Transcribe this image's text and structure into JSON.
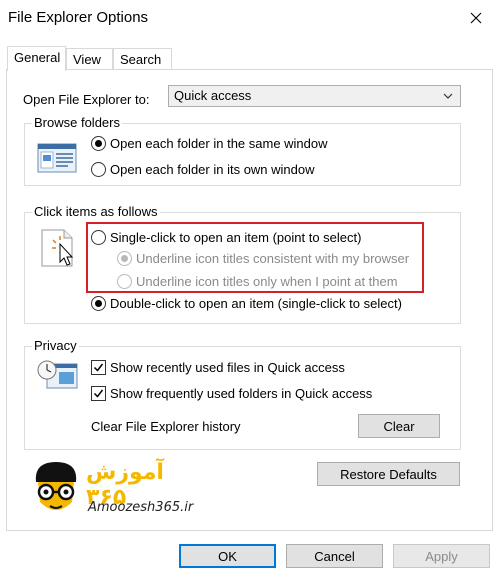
{
  "window": {
    "title": "File Explorer Options"
  },
  "tabs": [
    {
      "label": "General",
      "active": true
    },
    {
      "label": "View",
      "active": false
    },
    {
      "label": "Search",
      "active": false
    }
  ],
  "open_to": {
    "label": "Open File Explorer to:",
    "value": "Quick access"
  },
  "browse_folders": {
    "legend": "Browse folders",
    "options": [
      {
        "label": "Open each folder in the same window",
        "checked": true
      },
      {
        "label": "Open each folder in its own window",
        "checked": false
      }
    ]
  },
  "click_items": {
    "legend": "Click items as follows",
    "single_click": {
      "label": "Single-click to open an item (point to select)",
      "checked": false
    },
    "underline_consistent": {
      "label": "Underline icon titles consistent with my browser",
      "checked": true,
      "disabled": true
    },
    "underline_point": {
      "label": "Underline icon titles only when I point at them",
      "checked": false,
      "disabled": true
    },
    "double_click": {
      "label": "Double-click to open an item (single-click to select)",
      "checked": true
    }
  },
  "privacy": {
    "legend": "Privacy",
    "show_recent_files": {
      "label": "Show recently used files in Quick access",
      "checked": true
    },
    "show_frequent_folders": {
      "label": "Show frequently used folders in Quick access",
      "checked": true
    },
    "clear_history_label": "Clear File Explorer history",
    "clear_button": "Clear"
  },
  "restore_defaults": "Restore Defaults",
  "watermark": {
    "fa_text": "آموزش ۳۶۵",
    "en_text": "Amoozesh365.ir"
  },
  "footer": {
    "ok": "OK",
    "cancel": "Cancel",
    "apply": "Apply"
  },
  "colors": {
    "highlight_box": "#d42027",
    "focus_border": "#0078d7",
    "logo_yellow": "#f5b800"
  }
}
